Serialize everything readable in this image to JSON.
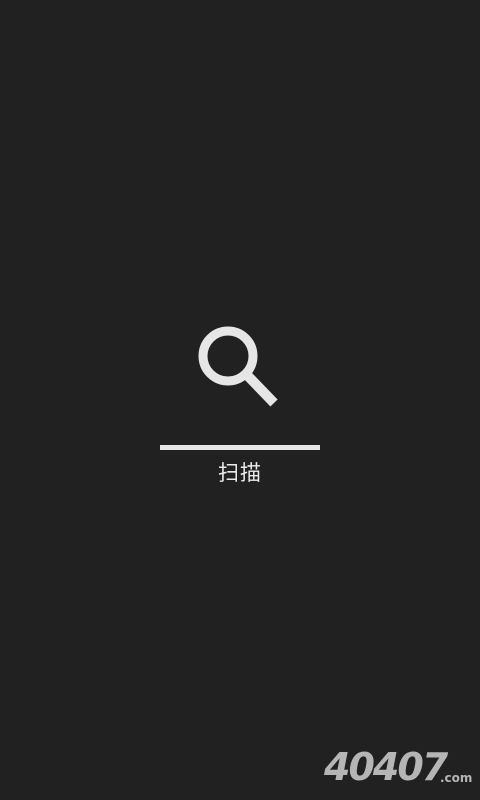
{
  "scan": {
    "status_label": "扫描",
    "progress": 1.0,
    "icon": "search-icon"
  },
  "watermark": {
    "main": "40407",
    "suffix": ".com"
  },
  "colors": {
    "background": "#212121",
    "foreground": "#e6e6e6",
    "watermark": "#cfcfcf"
  }
}
